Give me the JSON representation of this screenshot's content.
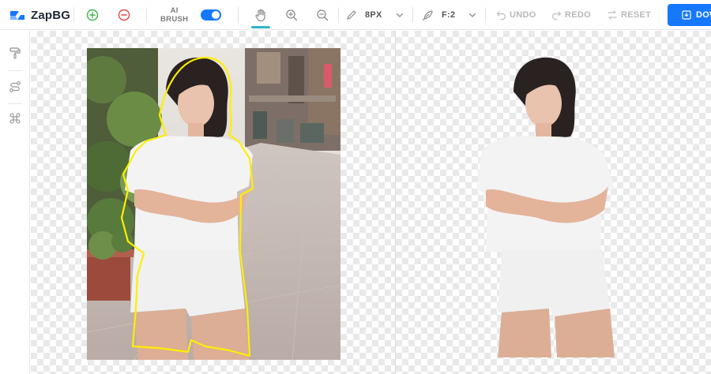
{
  "app": {
    "name": "ZapBG"
  },
  "toolbar": {
    "ai_brush_line1": "AI",
    "ai_brush_line2": "BRUSH",
    "ai_brush_enabled": true,
    "brush_size": "8PX",
    "feather": "F:2",
    "undo": "UNDO",
    "redo": "REDO",
    "reset": "RESET",
    "download": "DOWNLOAD"
  },
  "icons": {
    "add": "plus-circle-icon",
    "remove": "minus-circle-icon",
    "pan": "hand-icon",
    "zoom_in": "zoom-in-icon",
    "zoom_out": "zoom-out-icon",
    "brush": "pencil-icon",
    "feather": "feather-icon",
    "sidebar": [
      "paint-roller-icon",
      "route-icon",
      "command-icon"
    ]
  },
  "colors": {
    "accent": "#1677ff",
    "add": "#3cb44b",
    "remove": "#e5484d",
    "active_tool": "#2fb5c9",
    "selection_outline": "#ffee00"
  }
}
